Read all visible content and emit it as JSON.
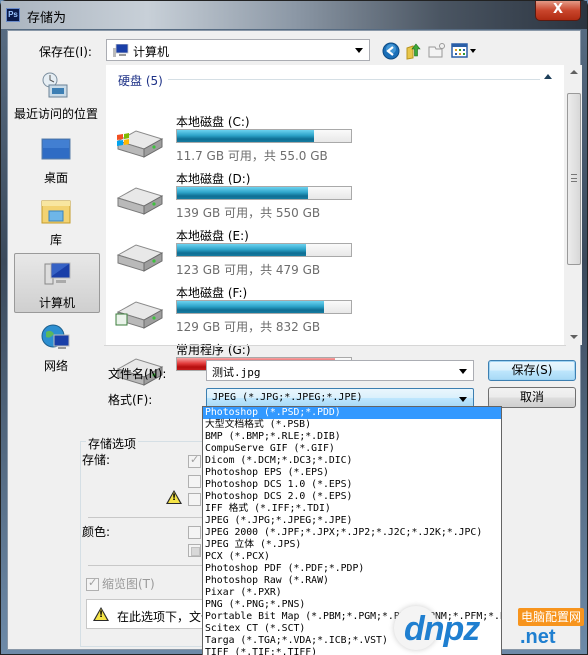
{
  "window": {
    "title": "存储为",
    "app_icon": "Ps",
    "close_label": "X"
  },
  "toolbar": {
    "save_in_label": "保存在(I):",
    "save_in_value": "计算机",
    "icons": [
      "back-icon",
      "up-folder-icon",
      "new-folder-icon",
      "view-menu-icon"
    ]
  },
  "places": [
    {
      "label": "最近访问的位置",
      "icon": "recent-places-icon"
    },
    {
      "label": "桌面",
      "icon": "desktop-icon"
    },
    {
      "label": "库",
      "icon": "libraries-icon"
    },
    {
      "label": "计算机",
      "icon": "computer-icon",
      "selected": true
    },
    {
      "label": "网络",
      "icon": "network-icon"
    }
  ],
  "file_list": {
    "group_header": "硬盘 (5)",
    "drives": [
      {
        "name": "本地磁盘 (C:)",
        "free": "11.7 GB 可用，共 55.0 GB",
        "used_fraction": 0.79,
        "color": "#1e8db5",
        "icon": "system-drive-icon"
      },
      {
        "name": "本地磁盘 (D:)",
        "free": "139 GB 可用，共 550 GB",
        "used_fraction": 0.75,
        "color": "#1e8db5",
        "icon": "hard-drive-icon"
      },
      {
        "name": "本地磁盘 (E:)",
        "free": "123 GB 可用，共 479 GB",
        "used_fraction": 0.74,
        "color": "#1e8db5",
        "icon": "hard-drive-icon"
      },
      {
        "name": "本地磁盘 (F:)",
        "free": "129 GB 可用，共 832 GB",
        "used_fraction": 0.845,
        "color": "#1e8db5",
        "icon": "hard-drive-icon"
      },
      {
        "name": "常用程序 (G:)",
        "free": "",
        "used_fraction": 0.91,
        "color": "#d42020",
        "icon": "hard-drive-icon"
      }
    ]
  },
  "form": {
    "filename_label": "文件名(N):",
    "filename_value": "测试.jpg",
    "format_label": "格式(F):",
    "format_value": "JPEG (*.JPG;*.JPEG;*.JPE)",
    "save_button": "保存(S)",
    "cancel_button": "取消"
  },
  "options": {
    "group_title": "存储选项",
    "save_label": "存储:",
    "color_label": "颜色:",
    "thumbnail_label": "缩览图(T)",
    "warning_text": "在此选项下，文件"
  },
  "format_options": [
    "Photoshop (*.PSD;*.PDD)",
    "大型文档格式 (*.PSB)",
    "BMP (*.BMP;*.RLE;*.DIB)",
    "CompuServe GIF (*.GIF)",
    "Dicom (*.DCM;*.DC3;*.DIC)",
    "Photoshop EPS (*.EPS)",
    "Photoshop DCS 1.0 (*.EPS)",
    "Photoshop DCS 2.0 (*.EPS)",
    "IFF 格式 (*.IFF;*.TDI)",
    "JPEG (*.JPG;*.JPEG;*.JPE)",
    "JPEG 2000 (*.JPF;*.JPX;*.JP2;*.J2C;*.J2K;*.JPC)",
    "JPEG 立体 (*.JPS)",
    "PCX (*.PCX)",
    "Photoshop PDF (*.PDF;*.PDP)",
    "Photoshop Raw (*.RAW)",
    "Pixar (*.PXR)",
    "PNG (*.PNG;*.PNS)",
    "Portable Bit Map (*.PBM;*.PGM;*.PPM;*.PNM;*.PFM;*.PAM)",
    "Scitex CT (*.SCT)",
    "Targa (*.TGA;*.VDA;*.ICB;*.VST)",
    "TIFF (*.TIF;*.TIFF)"
  ],
  "format_highlighted_index": 0,
  "watermark": {
    "brand": "dnpz",
    "suffix": ".net",
    "badge": "电脑配置网"
  }
}
